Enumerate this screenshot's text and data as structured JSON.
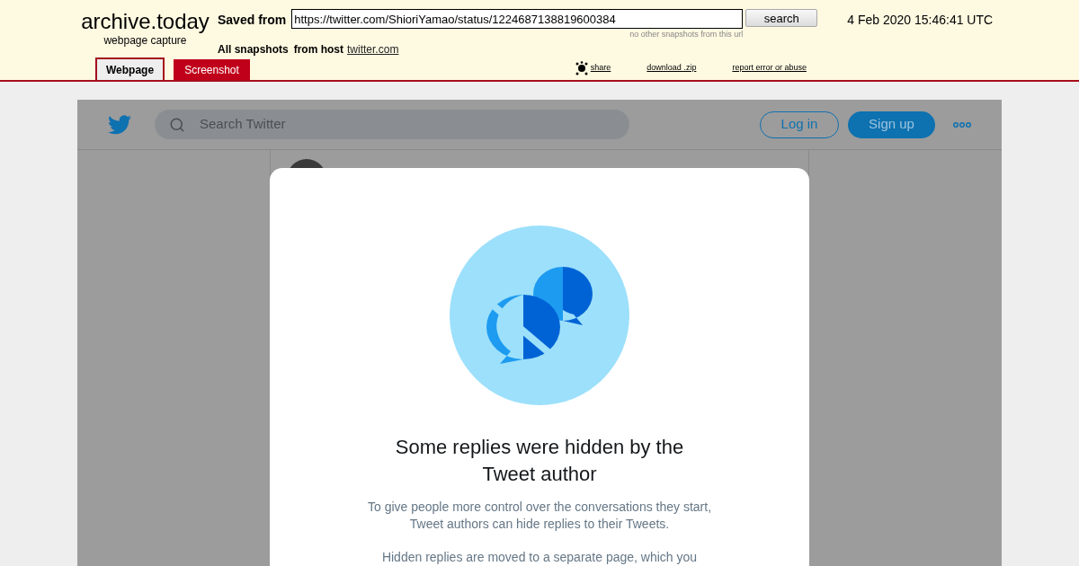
{
  "archive": {
    "logo": "archive.today",
    "subtitle": "webpage capture",
    "saved_from_label": "Saved from",
    "url": "https://twitter.com/ShioriYamao/status/1224687138819600384",
    "search_button": "search",
    "no_other": "no other snapshots from this url",
    "date": "4 Feb 2020 15:46:41 UTC",
    "all_snapshots": "All snapshots",
    "from_host": "from host",
    "host": "twitter.com",
    "tabs": [
      {
        "label": "Webpage",
        "selected": true
      },
      {
        "label": "Screenshot",
        "selected": false
      }
    ],
    "links": [
      "share",
      "download .zip",
      "report error or abuse"
    ]
  },
  "twitter": {
    "search_placeholder": "Search Twitter",
    "login": "Log in",
    "signup": "Sign up"
  },
  "modal": {
    "title": "Some replies were hidden by the Tweet author",
    "paragraphs": [
      "To give people more control over the conversations they start, Tweet authors can hide replies to their Tweets.",
      "Hidden replies are moved to a separate page, which you"
    ]
  }
}
